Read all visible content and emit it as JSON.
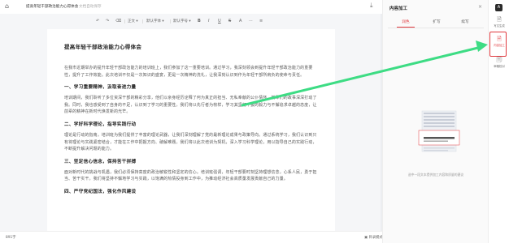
{
  "header": {
    "title": "提高年轻干部政治能力心得体会",
    "save_status": "文档自动保存"
  },
  "toolbar": {
    "undo": "↶",
    "redo": "↷",
    "format_painter": "⌫",
    "paragraph_style": "正文 ▾",
    "font_family": "默认字体 ▾",
    "font_size": "默认字号 ▾",
    "bold": "B",
    "italic": "I",
    "underline": "U",
    "strikethrough": "S",
    "font_color": "A",
    "more": "⋯",
    "align": "≡"
  },
  "document": {
    "heading": "提高年轻干部政治能力心得体会",
    "intro": "在我市近期举办的提升年轻干部政治能力的培训班上，我们参加了这一重要培训。通过学习，我深刻领会到提升年轻干部政治能力的重要性，提升了工作效能。此次培训不仅是一次知识的盛宴，更是一次精神的洗礼，让我深刻认识到作为年轻干部所肩负的使命与责任。",
    "sections": [
      {
        "title": "一、学习重要精神，汲取奋进力量",
        "body": "培训期间，我们聆听了多位资深干部的精彩分享，他们以亲身经历诠释了何为真正的担当、无私奉献的公仆情怀，前辈们的故事深深打动了我。同时，我也感受到了自身的不足，认识到了学习的重要性。我们将以先行者为榜样，学习其坚韧不拔的毅力与不懈追求卓越的态度，让前辈的精神在新时代焕发新的光芒。"
      },
      {
        "title": "二、学好科学理论，指导实践行动",
        "body": "理论是行动的指南。培训班为我们提供了丰富的理论武器，让我们深刻理解了党的最新理论成果与政策导向。通过系统学习，我们认识到只有将理论与实践紧密结合，才能在工作中把握方向、破解难题。我们将以此次培训为契机，深入学习科学理论，用以指导自己的实践行动，不断提升解决问题的能力。"
      },
      {
        "title": "三、坚定信心信念，保持苦干拼搏",
        "body": "面对新时代的挑战与机遇，我们必须保持高度的政治敏锐性和坚定的信心。培训班强调，年轻干部要时刻坚持理想信念，心系人民，勇于担当、苦干实干。我们将坚持不懈地学习与实践，以饱满的热情投身到工作中，为推动经济社会高质量发展贡献自己的力量。"
      },
      {
        "title": "四、严守党纪国法，强化作风建设",
        "body": ""
      }
    ]
  },
  "statusbar": {
    "word_count": "891字",
    "view_mode": "▣ 目录模式"
  },
  "panel": {
    "title": "内容加工",
    "close": "×",
    "tabs": [
      "润色",
      "扩写",
      "续写"
    ],
    "active_tab": "润色",
    "empty_hint": "选中一段文本提供加工内容和质量的建议"
  },
  "rail": {
    "avatar_text": "A",
    "items": [
      {
        "label": "写文生成",
        "icon": "file-write-icon"
      },
      {
        "label": "内容加工",
        "icon": "file-edit-icon"
      },
      {
        "label": "审稿校对",
        "icon": "review-icon"
      }
    ]
  },
  "colors": {
    "accent": "#e0393e",
    "annotation_arrow": "#3ddc84",
    "editor_background": "#f5f6f8"
  }
}
